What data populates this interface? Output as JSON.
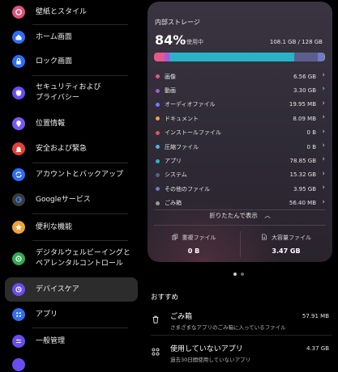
{
  "sidebar": {
    "items": [
      {
        "label": "壁紙とスタイル",
        "icon": "palette-icon",
        "color": "#e0507a"
      },
      {
        "label": "ホーム画面",
        "icon": "home-icon",
        "color": "#2f6df6"
      },
      {
        "label": "ロック画面",
        "icon": "lock-icon",
        "color": "#2f6df6"
      },
      {
        "label": "セキュリティおよび\nプライバシー",
        "icon": "shield-icon",
        "color": "#6a4cf0"
      },
      {
        "label": "位置情報",
        "icon": "location-icon",
        "color": "#7b57f0"
      },
      {
        "label": "安全および緊急",
        "icon": "alert-icon",
        "color": "#e0413a"
      },
      {
        "label": "アカウントとバックアップ",
        "icon": "sync-icon",
        "color": "#2f6df6"
      },
      {
        "label": "Googleサービス",
        "icon": "google-icon",
        "color": "#3b3b3b"
      },
      {
        "label": "便利な機能",
        "icon": "star-icon",
        "color": "#f0a23a"
      },
      {
        "label": "デジタルウェルビーイングと\nペアレンタルコントロール",
        "icon": "wellbeing-icon",
        "color": "#34a853"
      },
      {
        "label": "デバイスケア",
        "icon": "device-care-icon",
        "color": "#6a4cf0"
      },
      {
        "label": "アプリ",
        "icon": "apps-icon",
        "color": "#2f6df6"
      },
      {
        "label": "一般管理",
        "icon": "sliders-icon",
        "color": "#6a4cf0"
      }
    ]
  },
  "storage": {
    "title": "内部ストレージ",
    "percent": "84%",
    "percent_label": "使用中",
    "total": "108.1 GB / 128 GB",
    "categories": [
      {
        "label": "画像",
        "value": "6.56 GB",
        "color": "#e25a8a",
        "share": 6.07
      },
      {
        "label": "動画",
        "value": "3.30 GB",
        "color": "#a45bd6",
        "share": 3.05
      },
      {
        "label": "オーディオファイル",
        "value": "19.95 MB",
        "color": "#6a80ff",
        "share": 0.3
      },
      {
        "label": "ドキュメント",
        "value": "8.09 MB",
        "color": "#f0a040",
        "share": 0.3
      },
      {
        "label": "インストールファイル",
        "value": "0 B",
        "color": "#d35a5a",
        "share": 0
      },
      {
        "label": "圧縮ファイル",
        "value": "0 B",
        "color": "#4fb0e0",
        "share": 0
      },
      {
        "label": "アプリ",
        "value": "78.85 GB",
        "color": "#2ab3c6",
        "share": 72.94
      },
      {
        "label": "システム",
        "value": "15.32 GB",
        "color": "#5b5f8f",
        "share": 14.17
      },
      {
        "label": "その他のファイル",
        "value": "3.95 GB",
        "color": "#6d7cc4",
        "share": 3.65
      },
      {
        "label": "ごみ箱",
        "value": "56.40 MB",
        "color": "#9a9a9a",
        "share": 0.6
      }
    ],
    "collapse_label": "折りたたんで表示",
    "duplicate_label": "重複ファイル",
    "duplicate_value": "0 B",
    "large_label": "大容量ファイル",
    "large_value": "3.47 GB"
  },
  "recommend": {
    "title": "おすすめ",
    "items": [
      {
        "title": "ごみ箱",
        "subtitle": "さまざまなアプリのごみ箱に入っているファイル",
        "value": "57.91 MB",
        "icon": "trash-icon"
      },
      {
        "title": "使用していないアプリ",
        "subtitle": "過去30日間使用していないアプリ",
        "value": "4.37 GB",
        "icon": "apps-grid-icon"
      }
    ]
  }
}
